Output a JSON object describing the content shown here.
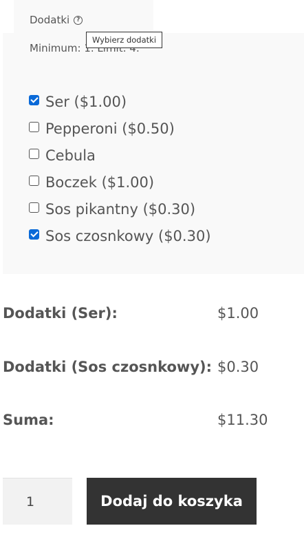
{
  "addon": {
    "title": "Dodatki",
    "help_icon": "question-circle-icon",
    "limit_text": "Minimum: 1. Limit: 4.",
    "tooltip": "Wybierz dodatki",
    "options": [
      {
        "label": "Ser ($1.00)",
        "checked": true
      },
      {
        "label": "Pepperoni ($0.50)",
        "checked": false
      },
      {
        "label": "Cebula",
        "checked": false
      },
      {
        "label": "Boczek ($1.00)",
        "checked": false
      },
      {
        "label": "Sos pikantny ($0.30)",
        "checked": false
      },
      {
        "label": "Sos czosnkowy ($0.30)",
        "checked": true
      }
    ]
  },
  "summary": {
    "rows": [
      {
        "label": "Dodatki (Ser):",
        "value": "$1.00"
      },
      {
        "label": "Dodatki (Sos czosnkowy):",
        "value": "$0.30"
      },
      {
        "label": "Suma:",
        "value": "$11.30"
      }
    ]
  },
  "cart": {
    "quantity": "1",
    "button_label": "Dodaj do koszyka"
  },
  "colors": {
    "panel_bg": "#f9f9f9",
    "button_bg": "#333333",
    "checkbox_checked": "#0a6ad8"
  }
}
